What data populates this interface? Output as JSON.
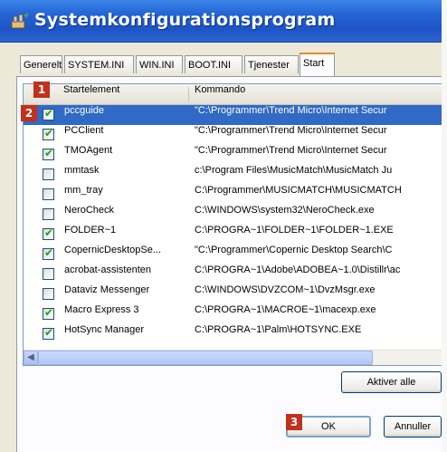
{
  "window": {
    "title": "Systemkonfigurationsprogram",
    "colors": {
      "titlebar": "#2463d4",
      "selection": "#3169c6",
      "badge": "#c1311d",
      "active_tab_border": "#e68b2c"
    }
  },
  "tabs": [
    {
      "label": "Generelt"
    },
    {
      "label": "SYSTEM.INI"
    },
    {
      "label": "WIN.INI"
    },
    {
      "label": "BOOT.INI"
    },
    {
      "label": "Tjenester"
    },
    {
      "label": "Start"
    }
  ],
  "active_tab": "Start",
  "list": {
    "headers": {
      "name": "Startelement",
      "command": "Kommando"
    },
    "rows": [
      {
        "name": "pccguide",
        "command": "\"C:\\Programmer\\Trend Micro\\Internet Secur",
        "checked": true,
        "selected": true
      },
      {
        "name": "PCClient",
        "command": "\"C:\\Programmer\\Trend Micro\\Internet Secur",
        "checked": true,
        "selected": false
      },
      {
        "name": "TMOAgent",
        "command": "\"C:\\Programmer\\Trend Micro\\Internet Secur",
        "checked": true,
        "selected": false
      },
      {
        "name": "mmtask",
        "command": "c:\\Program Files\\MusicMatch\\MusicMatch Ju",
        "checked": false,
        "selected": false
      },
      {
        "name": "mm_tray",
        "command": "C:\\Programmer\\MUSICMATCH\\MUSICMATCH",
        "checked": false,
        "selected": false
      },
      {
        "name": "NeroCheck",
        "command": "C:\\WINDOWS\\system32\\NeroCheck.exe",
        "checked": false,
        "selected": false
      },
      {
        "name": "FOLDER~1",
        "command": "C:\\PROGRA~1\\FOLDER~1\\FOLDER~1.EXE",
        "checked": true,
        "selected": false
      },
      {
        "name": "CopernicDesktopSe...",
        "command": "\"C:\\Programmer\\Copernic Desktop Search\\C",
        "checked": true,
        "selected": false
      },
      {
        "name": "acrobat-assistenten",
        "command": "C:\\PROGRA~1\\Adobe\\ADOBEA~1.0\\Distillr\\ac",
        "checked": false,
        "selected": false
      },
      {
        "name": "Dataviz Messenger",
        "command": "C:\\WINDOWS\\DVZCOM~1\\DvzMsgr.exe",
        "checked": false,
        "selected": false
      },
      {
        "name": "Macro Express 3",
        "command": "C:\\PROGRA~1\\MACROE~1\\macexp.exe",
        "checked": true,
        "selected": false
      },
      {
        "name": "HotSync Manager",
        "command": "C:\\PROGRA~1\\Palm\\HOTSYNC.EXE",
        "checked": true,
        "selected": false
      }
    ]
  },
  "buttons": {
    "enable_all": "Aktiver alle",
    "ok": "OK",
    "cancel": "Annuller"
  },
  "badges": [
    "1",
    "2",
    "3"
  ],
  "icons": {
    "app": "msconfig-icon",
    "check": "checkmark-icon",
    "scroll_left": "arrow-left-icon"
  }
}
